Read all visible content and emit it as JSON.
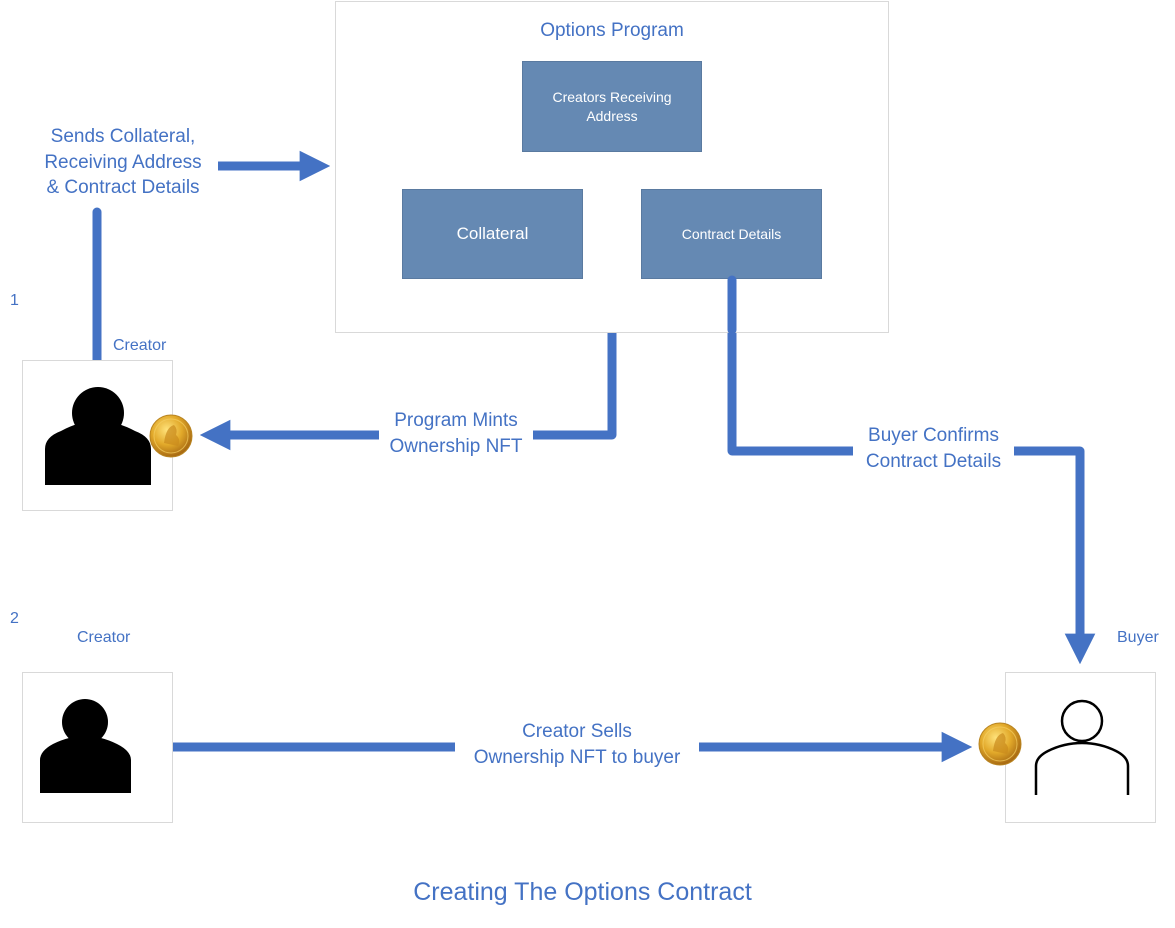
{
  "title": "Creating The Options Contract",
  "program": {
    "title": "Options Program",
    "boxes": {
      "receiving_address": "Creators Receiving Address",
      "collateral": "Collateral",
      "contract_details": "Contract Details"
    }
  },
  "steps": {
    "step1_number": "1",
    "step2_number": "2"
  },
  "actors": {
    "creator1_label": "Creator",
    "creator2_label": "Creator",
    "buyer_label": "Buyer"
  },
  "flows": {
    "sends": "Sends Collateral,\nReceiving Address\n& Contract Details",
    "mints": "Program Mints\nOwnership NFT",
    "confirms": "Buyer Confirms\nContract Details",
    "sells": "Creator Sells\nOwnership NFT to buyer"
  },
  "icons": {
    "creator": "person-filled-icon",
    "buyer": "person-outline-icon",
    "nft": "gold-coin-icon"
  },
  "colors": {
    "accent": "#4472c4",
    "box_fill": "#6589b3",
    "frame": "#d9d9d9"
  }
}
